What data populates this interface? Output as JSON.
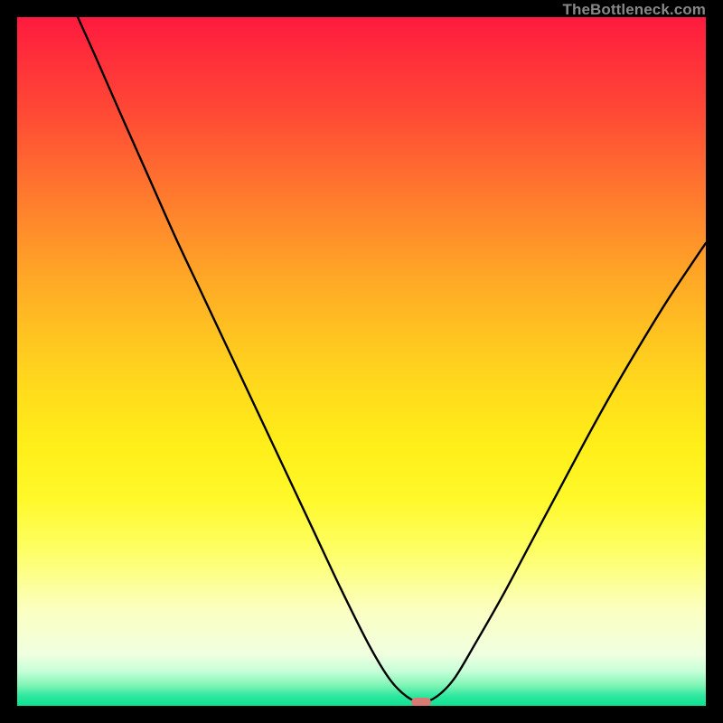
{
  "watermark": "TheBottleneck.com",
  "chart_data": {
    "type": "line",
    "title": "",
    "xlabel": "",
    "ylabel": "",
    "xlim": [
      0,
      100
    ],
    "ylim": [
      0,
      100
    ],
    "grid": false,
    "series": [
      {
        "name": "bottleneck-curve",
        "color": "#000000",
        "points": [
          {
            "x": 8.8,
            "y": 100.0
          },
          {
            "x": 11.5,
            "y": 94.0
          },
          {
            "x": 15.0,
            "y": 86.0
          },
          {
            "x": 19.0,
            "y": 77.0
          },
          {
            "x": 23.0,
            "y": 68.0
          },
          {
            "x": 27.0,
            "y": 59.5
          },
          {
            "x": 31.0,
            "y": 51.0
          },
          {
            "x": 35.0,
            "y": 42.5
          },
          {
            "x": 39.0,
            "y": 34.0
          },
          {
            "x": 43.0,
            "y": 25.5
          },
          {
            "x": 47.0,
            "y": 17.0
          },
          {
            "x": 51.0,
            "y": 9.0
          },
          {
            "x": 54.0,
            "y": 4.0
          },
          {
            "x": 56.5,
            "y": 1.4
          },
          {
            "x": 58.7,
            "y": 0.5
          },
          {
            "x": 61.0,
            "y": 1.4
          },
          {
            "x": 63.5,
            "y": 4.0
          },
          {
            "x": 66.5,
            "y": 9.0
          },
          {
            "x": 70.5,
            "y": 16.0
          },
          {
            "x": 74.5,
            "y": 23.5
          },
          {
            "x": 78.5,
            "y": 31.0
          },
          {
            "x": 82.5,
            "y": 38.5
          },
          {
            "x": 86.5,
            "y": 45.7
          },
          {
            "x": 90.5,
            "y": 52.5
          },
          {
            "x": 94.5,
            "y": 59.0
          },
          {
            "x": 98.5,
            "y": 65.0
          },
          {
            "x": 100.0,
            "y": 67.2
          }
        ]
      }
    ],
    "marker": {
      "x": 58.7,
      "y": 0.5,
      "color": "#d87a74"
    },
    "background": {
      "type": "vertical-gradient",
      "stops": [
        {
          "pos": 0.0,
          "color": "#ff1a3f"
        },
        {
          "pos": 0.5,
          "color": "#ffdd1c"
        },
        {
          "pos": 0.85,
          "color": "#fcffb0"
        },
        {
          "pos": 1.0,
          "color": "#0ce090"
        }
      ]
    }
  }
}
